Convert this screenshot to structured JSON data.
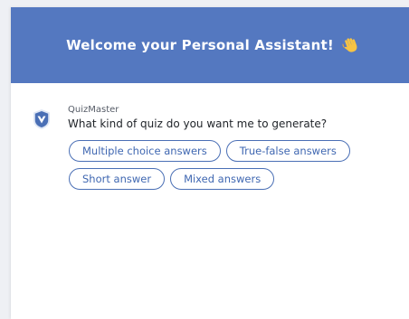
{
  "header": {
    "title": "Welcome your Personal Assistant!",
    "emoji_icon": "waving-hand-icon",
    "background_color": "#5478c0"
  },
  "message": {
    "sender": "QuizMaster",
    "avatar_icon": "quizmaster-shield-icon",
    "text": "What kind of quiz do you want me to generate?"
  },
  "options": [
    {
      "label": "Multiple choice answers"
    },
    {
      "label": "True-false answers"
    },
    {
      "label": "Short answer"
    },
    {
      "label": "Mixed answers"
    }
  ],
  "colors": {
    "accent": "#4a6fb5",
    "option_text": "#3f67b1"
  }
}
